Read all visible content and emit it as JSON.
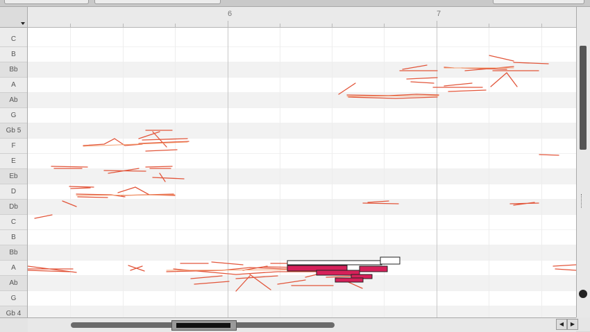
{
  "ruler": {
    "bar_labels": [
      {
        "text": "6"
      },
      {
        "text": "7"
      }
    ]
  },
  "pitch_keys": [
    {
      "label": "C",
      "dark": false
    },
    {
      "label": "B",
      "dark": false
    },
    {
      "label": "Bb",
      "dark": true
    },
    {
      "label": "A",
      "dark": false
    },
    {
      "label": "Ab",
      "dark": true
    },
    {
      "label": "G",
      "dark": false
    },
    {
      "label": "Gb 5",
      "dark": true
    },
    {
      "label": "F",
      "dark": false
    },
    {
      "label": "E",
      "dark": false
    },
    {
      "label": "Eb",
      "dark": true
    },
    {
      "label": "D",
      "dark": false
    },
    {
      "label": "Db",
      "dark": true
    },
    {
      "label": "C",
      "dark": false
    },
    {
      "label": "B",
      "dark": false
    },
    {
      "label": "Bb",
      "dark": true
    },
    {
      "label": "A",
      "dark": false
    },
    {
      "label": "Ab",
      "dark": true
    },
    {
      "label": "G",
      "dark": false
    },
    {
      "label": "Gb 4",
      "dark": true
    }
  ],
  "colors": {
    "blob_stroke": "#e2553a",
    "blob_fill": "#f4a172",
    "selected_fill": "#d6215a",
    "selected_outline": "#222222"
  },
  "icons": {
    "key_menu": "chevron-down-icon",
    "scroll_left": "arrow-left-icon",
    "scroll_right": "arrow-right-icon"
  }
}
